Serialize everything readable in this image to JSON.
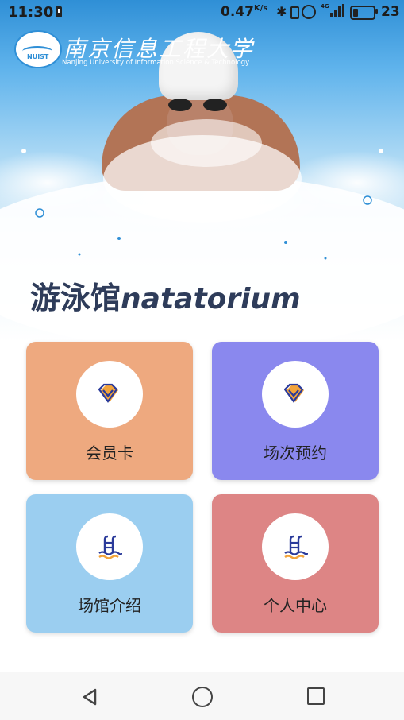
{
  "status_bar": {
    "time": "11:30",
    "net_speed": "0.47",
    "net_speed_unit": "K/s",
    "network_type": "4G",
    "battery_level": 23,
    "battery_percent_text": "23"
  },
  "header": {
    "university_cn": "南京信息工程大学",
    "university_en": "Nanjing University of Information Science & Technology",
    "logo_text": "NUIST"
  },
  "title": {
    "cn": "游泳馆",
    "en": "natatorium"
  },
  "menu": [
    {
      "label": "会员卡",
      "icon": "gem-icon",
      "color": "#eea97f"
    },
    {
      "label": "场次预约",
      "icon": "gem-icon",
      "color": "#8a88ee"
    },
    {
      "label": "场馆介绍",
      "icon": "pool-ladder-icon",
      "color": "#9bcef0"
    },
    {
      "label": "个人中心",
      "icon": "pool-ladder-icon",
      "color": "#dd8585"
    }
  ],
  "colors": {
    "title": "#2e3c5a",
    "icon_primary": "#2a3a9a",
    "icon_accent": "#f2a33a"
  }
}
